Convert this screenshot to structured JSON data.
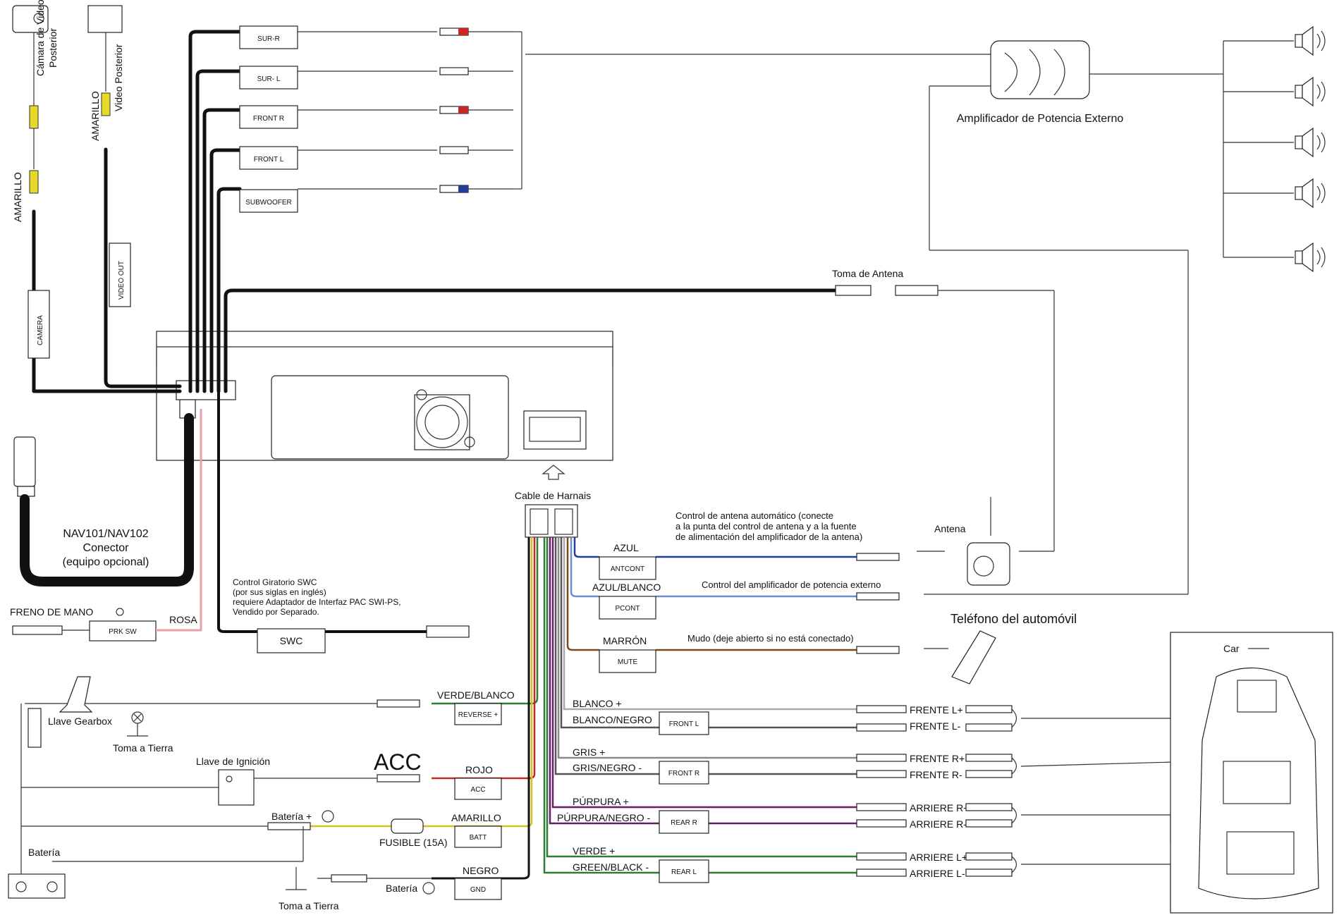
{
  "devices": {
    "camera_top": "Cámara de Video",
    "camera_bottom": "Posterior",
    "video_rear": "Video Posterior",
    "amarillo_left": "AMARILLO",
    "amarillo_mid": "AMARILLO",
    "camera_box": "CAMERA",
    "video_out_box": "VIDEO OUT",
    "nav_line1": "NAV101/NAV102",
    "nav_line2": "Conector",
    "nav_line3": "(equipo opcional)",
    "freno": "FRENO DE MANO",
    "rosa": "ROSA",
    "prk_sw": "PRK SW",
    "swc_box": "SWC",
    "swc_note1": "Control Giratorio SWC",
    "swc_note2": "(por sus siglas en inglés)",
    "swc_note3": "requiere Adaptador de Interfaz PAC SWI-PS,",
    "swc_note4": "Vendido por Separado.",
    "cable_harnais": "Cable de Harnais",
    "toma_antena": "Toma de Antena",
    "amp_label": "Amplificador de Potencia Externo",
    "antena": "Antena",
    "telefono": "Teléfono del automóvil",
    "car": "Car",
    "llave_gearbox": "Llave Gearbox",
    "toma_tierra1": "Toma a Tierra",
    "toma_tierra2": "Toma a Tierra",
    "llave_ignicion": "Llave de Ignición",
    "acc_big": "ACC",
    "bateria_plus": "Batería +",
    "fusible": "FUSIBLE (15A)",
    "bateria": "Batería",
    "bateria_minus": "Batería"
  },
  "rca_outputs": [
    "SUR-R",
    "SUR- L",
    "FRONT R",
    "FRONT L",
    "SUBWOOFER"
  ],
  "harness": {
    "azul": "AZUL",
    "antcont": "ANTCONT",
    "antcont_note1": "Control de antena automático (conecte",
    "antcont_note2": "a la punta del control de antena y a la fuente",
    "antcont_note3": "de alimentación del amplificador de la antena)",
    "azul_blanco": "AZUL/BLANCO",
    "pcont": "PCONT",
    "pcont_note": "Control del amplificador de potencia externo",
    "marron": "MARRÓN",
    "mute": "MUTE",
    "mute_note": "Mudo (deje abierto si no está conectado)",
    "verde_blanco": "VERDE/BLANCO",
    "reverse": "REVERSE +",
    "rojo": "ROJO",
    "acc": "ACC",
    "amarillo": "AMARILLO",
    "batt": "BATT",
    "negro": "NEGRO",
    "gnd": "GND"
  },
  "speakers": [
    {
      "wire_pos": "BLANCO +",
      "wire_neg": "BLANCO/NEGRO",
      "box": "FRONT L",
      "out_pos": "FRENTE L+",
      "out_neg": "FRENTE L-"
    },
    {
      "wire_pos": "GRIS +",
      "wire_neg": "GRIS/NEGRO -",
      "box": "FRONT R",
      "out_pos": "FRENTE R+",
      "out_neg": "FRENTE R-"
    },
    {
      "wire_pos": "PÚRPURA +",
      "wire_neg": "PÚRPURA/NEGRO -",
      "box": "REAR R",
      "out_pos": "ARRIERE R+",
      "out_neg": "ARRIERE R-"
    },
    {
      "wire_pos": "VERDE +",
      "wire_neg": "GREEN/BLACK -",
      "box": "REAR L",
      "out_pos": "ARRIERE L+",
      "out_neg": "ARRIERE L-"
    }
  ],
  "colors": {
    "blue": "#1f3f9a",
    "brown": "#7a4a1c",
    "green": "#2e7d32",
    "red": "#c62828",
    "yellow": "#d4c21a",
    "pink": "#e8a0a8",
    "purple": "#6a1b6a",
    "gray": "#8a8a8a"
  },
  "icons": [
    "speaker-icon",
    "fan-icon",
    "amplifier-icon",
    "antenna-icon",
    "phone-icon",
    "car-icon",
    "key-icon",
    "fuse-icon",
    "ground-icon",
    "battery-icon",
    "gear-lever-icon",
    "lamp-icon"
  ]
}
